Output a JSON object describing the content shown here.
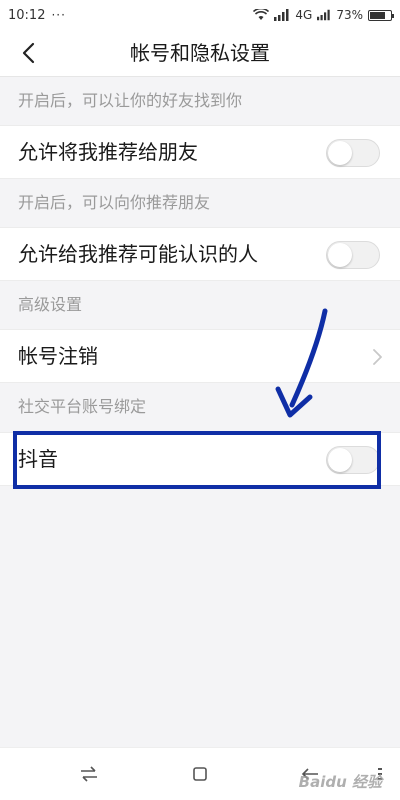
{
  "status_bar": {
    "time": "10:12",
    "dots": "···",
    "network": "4G",
    "battery_text": "73%",
    "battery_level": 0.73,
    "wifi_icon": "wifi-icon",
    "signal_icon": "signal-icon"
  },
  "header": {
    "title": "帐号和隐私设置",
    "back_icon": "back-arrow-icon"
  },
  "sections": [
    {
      "header": "开启后，可以让你的好友找到你",
      "row": {
        "label": "允许将我推荐给朋友",
        "control": "toggle",
        "on": false
      }
    },
    {
      "header": "开启后，可以向你推荐朋友",
      "row": {
        "label": "允许给我推荐可能认识的人",
        "control": "toggle",
        "on": false
      }
    },
    {
      "header": "高级设置",
      "row": {
        "label": "帐号注销",
        "control": "chevron"
      }
    },
    {
      "header": "社交平台账号绑定",
      "row": {
        "label": "抖音",
        "control": "toggle",
        "on": false
      }
    }
  ],
  "annotation": {
    "highlight_color": "#0f2ea6",
    "arrow_color": "#0f2ea6"
  },
  "bottom_nav": [
    "swap-icon",
    "recent-apps-icon",
    "back-icon",
    "menu-icon"
  ],
  "watermark": "Baidu 经验",
  "colors": {
    "background": "#f4f4f6",
    "row_background": "#ffffff",
    "section_text": "#9a9a9a",
    "toggle_off": "#f1f1f1"
  }
}
